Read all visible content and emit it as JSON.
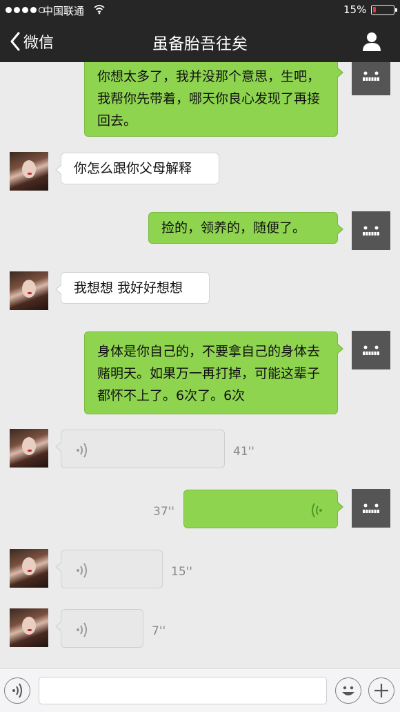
{
  "status_bar": {
    "carrier": "中国联通",
    "battery_percent": "15%",
    "battery_level": 0.15,
    "signal_bars_filled": 4,
    "signal_bars_total": 5
  },
  "nav": {
    "back_label": "微信",
    "title": "虽备胎吾往矣",
    "back_icon": "chevron-left-icon",
    "profile_icon": "person-icon"
  },
  "messages": [
    {
      "sender": "me",
      "type": "text",
      "text": "你想太多了，我并没那个意思，生吧，我帮你先带着，哪天你良心发现了再接回去。"
    },
    {
      "sender": "her",
      "type": "text",
      "text": "你怎么跟你父母解释"
    },
    {
      "sender": "me",
      "type": "text",
      "text": "捡的，领养的，随便了。"
    },
    {
      "sender": "her",
      "type": "text",
      "text": "我想想 我好好想想"
    },
    {
      "sender": "me",
      "type": "text",
      "text": "身体是你自己的，不要拿自己的身体去赌明天。如果万一再打掉，可能这辈子都怀不上了。6次了。6次"
    },
    {
      "sender": "her",
      "type": "voice",
      "duration": "41''"
    },
    {
      "sender": "me",
      "type": "voice",
      "duration": "37''"
    },
    {
      "sender": "her",
      "type": "voice",
      "duration": "15''"
    },
    {
      "sender": "her",
      "type": "voice",
      "duration": "7''"
    }
  ],
  "input_bar": {
    "voice_icon": "voice-mode-icon",
    "input_value": "",
    "emoji_icon": "emoji-icon",
    "plus_icon": "plus-icon"
  },
  "colors": {
    "nav_background": "#262626",
    "chat_background": "#ebebeb",
    "my_bubble": "#8ed44f",
    "her_bubble": "#ffffff",
    "voice_icon_mine": "#4a9a2a",
    "battery_low": "#e23b3b"
  }
}
